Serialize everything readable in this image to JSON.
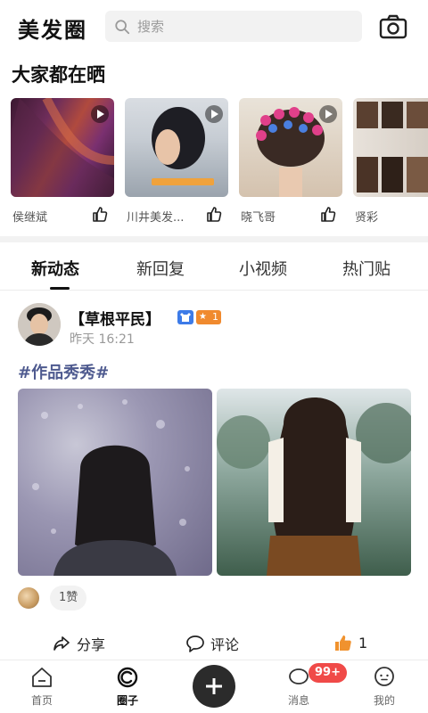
{
  "header": {
    "logo": "美发圈",
    "search_placeholder": "搜索"
  },
  "section": {
    "title": "大家都在晒"
  },
  "videos": [
    {
      "author": "侯继斌"
    },
    {
      "author": "川井美发..."
    },
    {
      "author": "晓飞哥"
    },
    {
      "author": "贤彩"
    }
  ],
  "tabs": [
    {
      "label": "新动态",
      "active": true
    },
    {
      "label": "新回复",
      "active": false
    },
    {
      "label": "小视频",
      "active": false
    },
    {
      "label": "热门贴",
      "active": false
    }
  ],
  "post": {
    "username": "【草根平民】",
    "level": "1",
    "time": "昨天 16:21",
    "hashtag": "#作品秀秀#",
    "likes_label": "1赞",
    "actions": {
      "share": "分享",
      "comment": "评论",
      "like_count": "1"
    }
  },
  "bottom_nav": {
    "home": "首页",
    "circle": "圈子",
    "messages": "消息",
    "messages_badge": "99+",
    "mine": "我的"
  },
  "colors": {
    "accent_badge": "#f04a48",
    "vip_badge": "#3d7be8",
    "level_badge": "#f08a2e",
    "hashtag": "#4e5a8f",
    "like_orange": "#f0922e"
  }
}
